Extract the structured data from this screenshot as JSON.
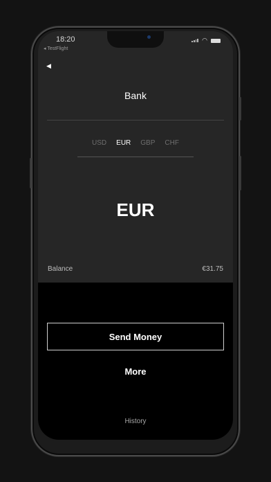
{
  "status_bar": {
    "time": "18:20",
    "back_app": "◂ TestFlight"
  },
  "header": {
    "back_icon": "back-arrow-icon",
    "title": "Bank"
  },
  "currency_tabs": [
    {
      "label": "USD",
      "active": false
    },
    {
      "label": "EUR",
      "active": true
    },
    {
      "label": "GBP",
      "active": false
    },
    {
      "label": "CHF",
      "active": false
    }
  ],
  "selected_currency": "EUR",
  "balance": {
    "label": "Balance",
    "value": "€31.75"
  },
  "actions": {
    "send_money_label": "Send Money",
    "more_label": "More",
    "history_label": "History"
  },
  "colors": {
    "background": "#131313",
    "screen": "#262626",
    "action_panel": "#000000",
    "active_tab": "#ffffff",
    "inactive_tab": "#6f6f6f"
  }
}
